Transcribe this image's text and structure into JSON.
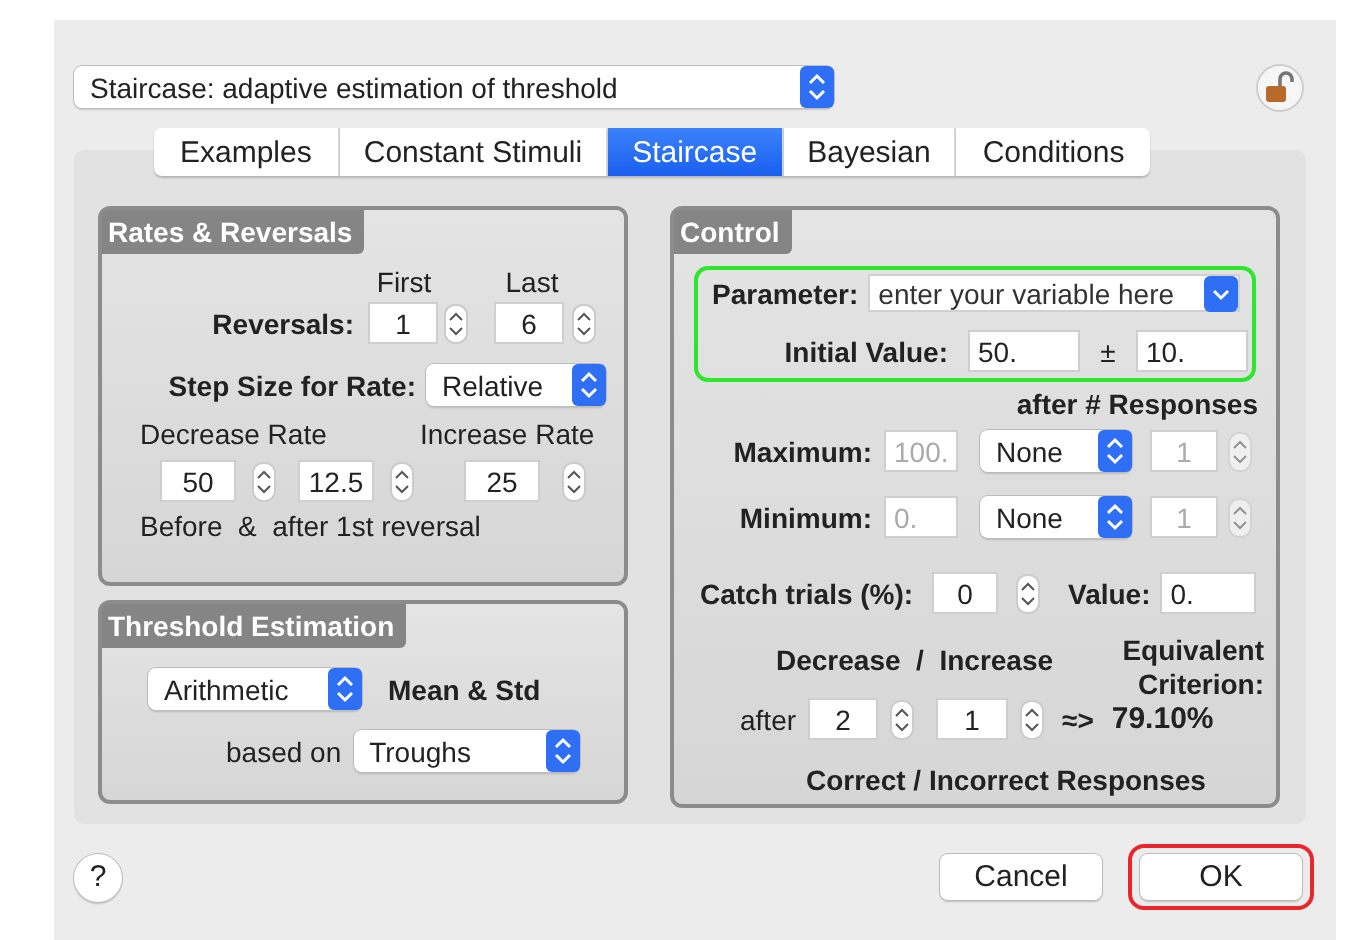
{
  "mode_popup": {
    "value": "Staircase: adaptive estimation of threshold"
  },
  "tabs": [
    {
      "label": "Examples",
      "selected": false
    },
    {
      "label": "Constant Stimuli",
      "selected": false
    },
    {
      "label": "Staircase",
      "selected": true
    },
    {
      "label": "Bayesian",
      "selected": false
    },
    {
      "label": "Conditions",
      "selected": false
    }
  ],
  "rates_reversals": {
    "title": "Rates & Reversals",
    "first_label": "First",
    "last_label": "Last",
    "reversals_label": "Reversals:",
    "first": "1",
    "last": "6",
    "step_size_label": "Step Size for Rate:",
    "step_size": "Relative",
    "decrease_label": "Decrease Rate",
    "increase_label": "Increase Rate",
    "decrease_before": "50",
    "decrease_after": "12.5",
    "increase": "25",
    "note": "Before  &  after 1st reversal"
  },
  "threshold_estimation": {
    "title": "Threshold Estimation",
    "method": "Arithmetic",
    "method_label": "Mean & Std",
    "based_on_label": "based on",
    "based_on": "Troughs"
  },
  "control": {
    "title": "Control",
    "highlighted": true,
    "parameter_label": "Parameter:",
    "parameter_placeholder": "enter your variable here",
    "initial_label": "Initial Value:",
    "initial": "50.",
    "plus_minus": "±",
    "spread": "10.",
    "after_label": "after # Responses",
    "limits": [
      {
        "label": "Maximum:",
        "value": "100.",
        "mode": "None",
        "count": "1",
        "disabled": true
      },
      {
        "label": "Minimum:",
        "value": "0.",
        "mode": "None",
        "count": "1",
        "disabled": true
      }
    ],
    "catch_label": "Catch trials (%):",
    "catch": "0",
    "value_label": "Value:",
    "value": "0.",
    "dec_inc_label": "Decrease  /  Increase",
    "equivalent_label": "Equivalent Criterion:",
    "after": "after",
    "decrease": "2",
    "increase": "1",
    "arrow": "≈>",
    "criterion": "79.10%",
    "footer": "Correct / Incorrect Responses"
  },
  "help_button": {
    "label": "?"
  },
  "buttons": [
    {
      "label": "Cancel",
      "highlighted": false
    },
    {
      "label": "OK",
      "highlighted": true
    }
  ]
}
